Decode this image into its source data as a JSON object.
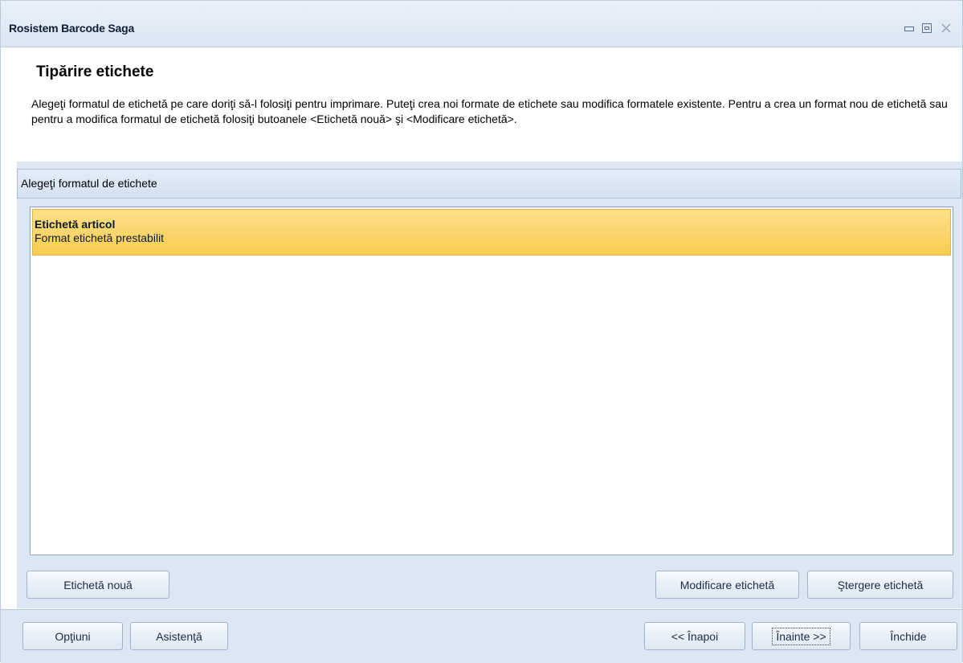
{
  "window": {
    "title": "Rosistem Barcode Saga"
  },
  "header": {
    "title": "Tipărire etichete",
    "description": "Alegeţi formatul de etichetă pe care doriţi să-l folosiţi pentru imprimare. Puteţi crea noi formate de etichete sau modifica formatele existente. Pentru a crea un format nou de etichetă sau pentru a modifica formatul de etichetă folosiţi butoanele <Etichetă nouă> şi <Modificare etichetă>."
  },
  "group": {
    "label": "Alegeţi formatul de etichete"
  },
  "label_formats": [
    {
      "name": "Etichetă articol",
      "description": "Format etichetă prestabilit",
      "selected": true
    }
  ],
  "list_buttons": {
    "new": "Etichetă nouă",
    "modify": "Modificare etichetă",
    "delete": "Ştergere etichetă"
  },
  "footer": {
    "options": "Opţiuni",
    "help": "Asistenţă",
    "back": "<< Înapoi",
    "next": "Înainte >>",
    "close": "Închide"
  },
  "colors": {
    "selected_item": "#f8cc4f",
    "panel_background": "#dde7f3"
  }
}
